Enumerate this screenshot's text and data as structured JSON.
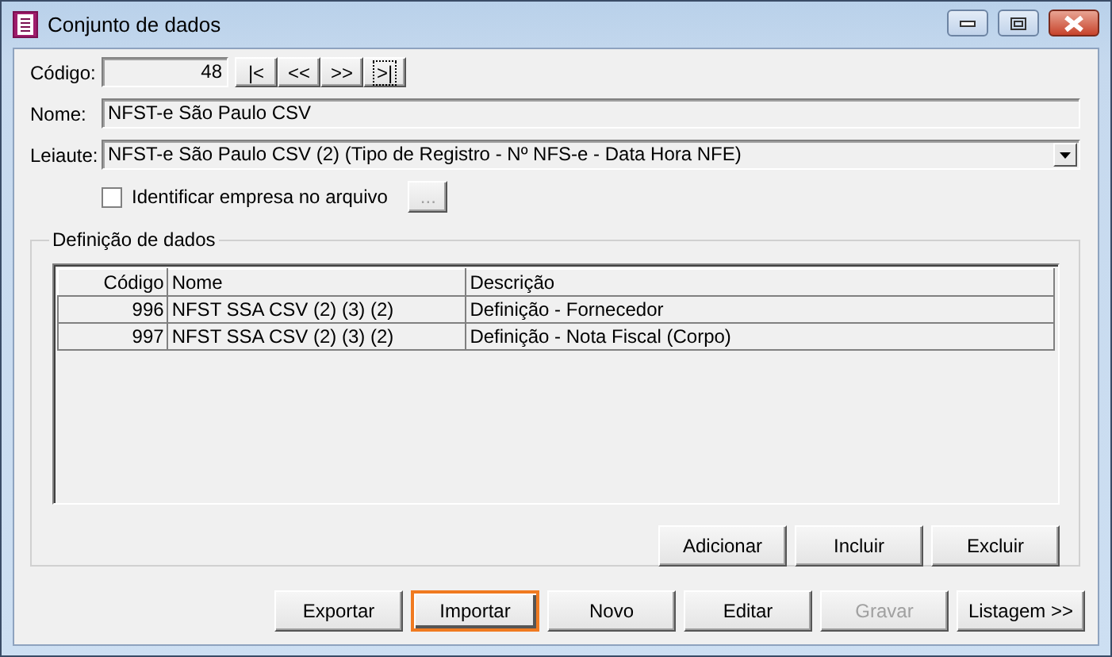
{
  "window": {
    "title": "Conjunto de dados"
  },
  "codigo": {
    "label": "Código:",
    "value": "48"
  },
  "navigation": [
    {
      "label": "|<",
      "focused": false
    },
    {
      "label": "<<",
      "focused": false
    },
    {
      "label": ">>",
      "focused": false
    },
    {
      "label": ">|",
      "focused": true
    }
  ],
  "nome": {
    "label": "Nome:",
    "value": "NFST-e São Paulo CSV"
  },
  "leiaute": {
    "label": "Leiaute:",
    "value": "NFST-e São Paulo CSV (2) (Tipo de Registro - Nº NFS-e - Data Hora NFE)"
  },
  "identificar": {
    "label": "Identificar empresa no arquivo",
    "checked": false,
    "button": "..."
  },
  "group": {
    "title": "Definição de dados",
    "table": {
      "columns": [
        "Código",
        "Nome",
        "Descrição"
      ],
      "rows": [
        [
          "996",
          "NFST SSA CSV (2) (3) (2)",
          "Definição - Fornecedor"
        ],
        [
          "997",
          "NFST SSA CSV (2) (3) (2)",
          "Definição - Nota Fiscal (Corpo)"
        ]
      ]
    },
    "buttons": [
      {
        "label": "Adicionar",
        "disabled": false,
        "highlighted": false
      },
      {
        "label": "Incluir",
        "disabled": false,
        "highlighted": false
      },
      {
        "label": "Excluir",
        "disabled": false,
        "highlighted": false
      }
    ]
  },
  "buttons": [
    {
      "label": "Exportar",
      "disabled": false,
      "highlighted": false
    },
    {
      "label": "Importar",
      "disabled": false,
      "highlighted": true
    },
    {
      "label": "Novo",
      "disabled": false,
      "highlighted": false
    },
    {
      "label": "Editar",
      "disabled": false,
      "highlighted": false
    },
    {
      "label": "Gravar",
      "disabled": true,
      "highlighted": false
    },
    {
      "label": "Listagem >>",
      "disabled": false,
      "highlighted": false
    }
  ]
}
